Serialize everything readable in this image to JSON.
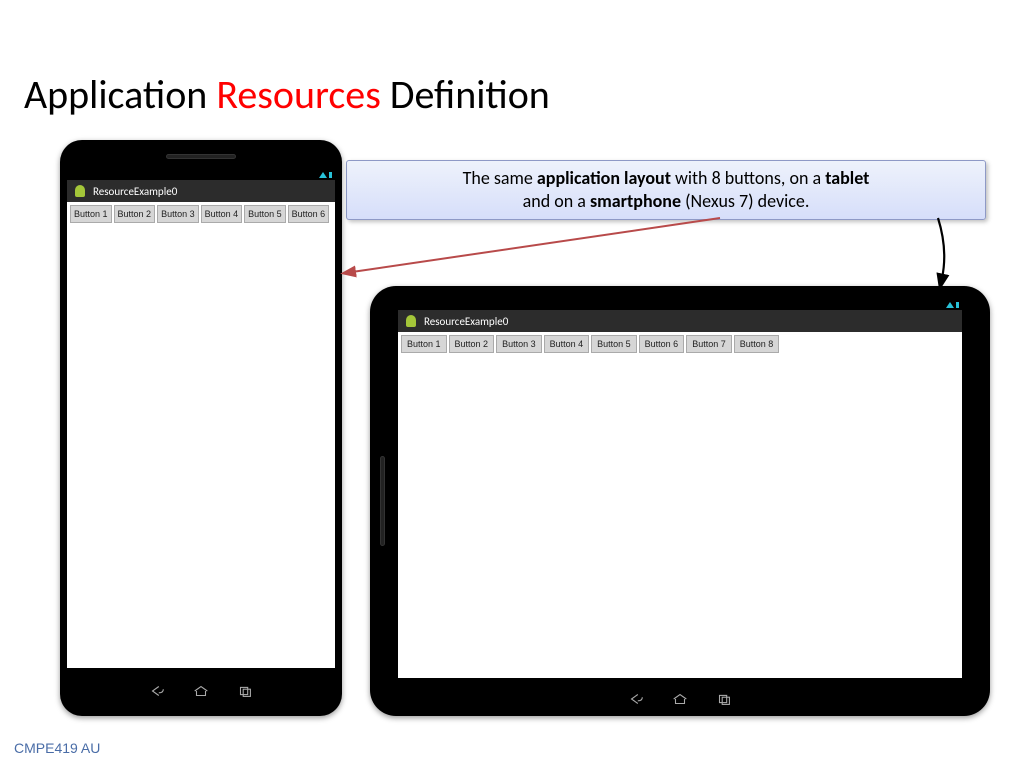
{
  "title": {
    "part1": "Application ",
    "part2": "Resources",
    "part3": " Definition"
  },
  "callout": {
    "text_pre": "The same ",
    "bold1": "application layout",
    "text_mid1": " with 8 buttons, on a ",
    "bold2": "tablet",
    "text_mid2": " and on a ",
    "bold3": "smartphone",
    "text_post": " (Nexus 7) device."
  },
  "app": {
    "title": "ResourceExample0"
  },
  "phone_buttons": [
    "Button 1",
    "Button 2",
    "Button 3",
    "Button 4",
    "Button 5",
    "Button 6"
  ],
  "tablet_buttons": [
    "Button 1",
    "Button 2",
    "Button 3",
    "Button 4",
    "Button 5",
    "Button 6",
    "Button 7",
    "Button 8"
  ],
  "footer": "CMPE419 AU"
}
